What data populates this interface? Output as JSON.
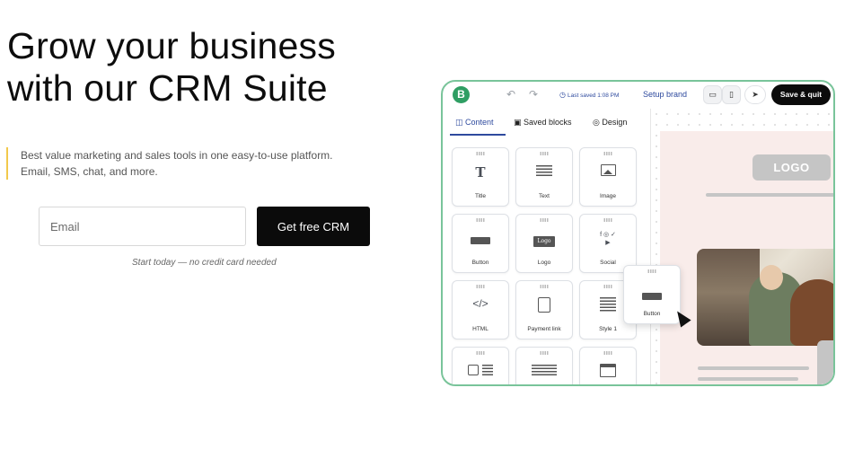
{
  "hero": {
    "headline_line1": "Grow your business",
    "headline_line2": "with our CRM Suite",
    "sub_line1": "Best value marketing and sales tools in one easy-to-use platform.",
    "sub_line2": "Email, SMS, chat, and more.",
    "accent_color": "#f2c94c"
  },
  "signup": {
    "email_placeholder": "Email",
    "cta_label": "Get free CRM",
    "note": "Start today — no credit card needed"
  },
  "editor": {
    "brand_letter": "B",
    "brand_color": "#2f9e63",
    "undo_icon": "↶",
    "redo_icon": "↷",
    "last_saved": "Last saved 1:08 PM",
    "setup_brand": "Setup brand",
    "save_quit": "Save & quit",
    "tabs": {
      "content": "Content",
      "saved_blocks": "Saved blocks",
      "design": "Design"
    },
    "blocks": [
      {
        "label": "Title",
        "icon": "title-icon"
      },
      {
        "label": "Text",
        "icon": "text-icon"
      },
      {
        "label": "Image",
        "icon": "image-icon"
      },
      {
        "label": "Button",
        "icon": "button-icon"
      },
      {
        "label": "Logo",
        "icon": "logo-icon"
      },
      {
        "label": "Social",
        "icon": "social-icon"
      },
      {
        "label": "HTML",
        "icon": "html-icon"
      },
      {
        "label": "Payment link",
        "icon": "payment-link-icon"
      },
      {
        "label": "Style 1",
        "icon": "style-1-icon"
      }
    ],
    "logo_block_text": "Logo",
    "title_glyph": "T",
    "html_glyph": "</>",
    "social_glyphs": "f ◎ ✓ ▶",
    "preview_logo": "LOGO",
    "drag_block_label": "Button"
  }
}
